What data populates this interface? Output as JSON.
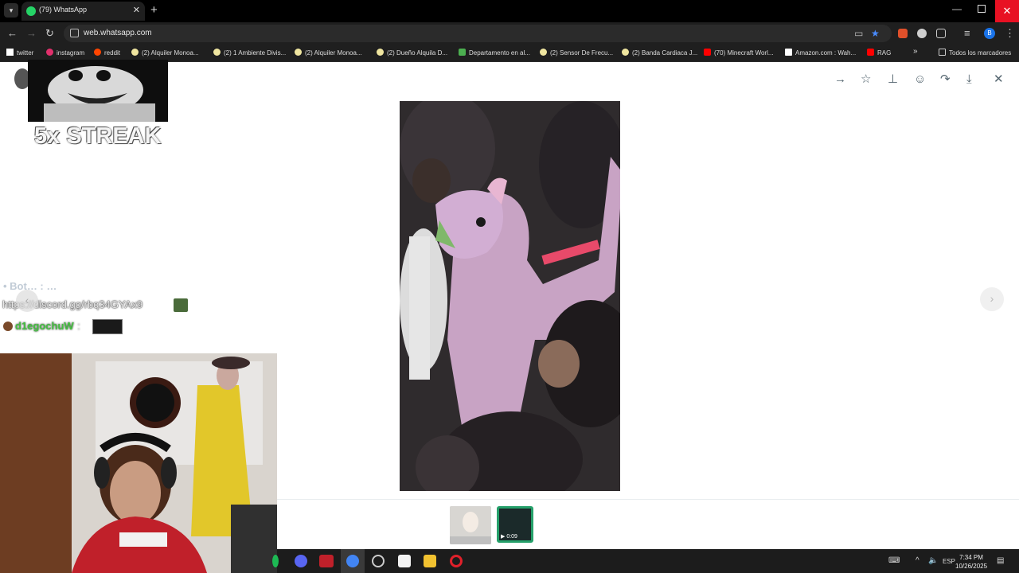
{
  "browser": {
    "tab_title": "(79) WhatsApp",
    "url": "web.whatsapp.com",
    "profile_initial": "B"
  },
  "bookmarks": [
    {
      "label": "twitter",
      "color": "#ffffff"
    },
    {
      "label": "instagram",
      "color": "#e1306c"
    },
    {
      "label": "reddit",
      "color": "#ff4500"
    },
    {
      "label": "(2) Alquiler Monoa...",
      "color": "#f0e6a0"
    },
    {
      "label": "(2) 1 Ambiente Divis...",
      "color": "#f0e6a0"
    },
    {
      "label": "(2) Alquiler Monoa...",
      "color": "#f0e6a0"
    },
    {
      "label": "(2) Dueño Alquila D...",
      "color": "#f0e6a0"
    },
    {
      "label": "Departamento en al...",
      "color": "#4caf50"
    },
    {
      "label": "(2) Sensor De Frecu...",
      "color": "#f0e6a0"
    },
    {
      "label": "(2) Banda Cardiaca J...",
      "color": "#f0e6a0"
    },
    {
      "label": "(70) Minecraft Worl...",
      "color": "#ff0000"
    },
    {
      "label": "Amazon.com : Wah...",
      "color": "#ffffff"
    },
    {
      "label": "RAG",
      "color": "#ff0000"
    }
  ],
  "bookmarks_more": "»",
  "all_bookmarks": "Todos los marcadores",
  "viewer": {
    "video_duration": "0:09"
  },
  "overlay": {
    "streak_text": "5x STREAK",
    "chat_faded": "• Bot… : …",
    "chat_link": "https://discord.gg/rbq34GYAx9",
    "chat_user": "d1egochuW",
    "chat_colon": ":"
  },
  "taskbar": {
    "language": "ESP",
    "time": "7:34 PM",
    "date": "10/26/2025"
  },
  "colors": {
    "whatsapp_green": "#25d366",
    "close_red": "#e81123",
    "icon_gray": "#54656f"
  }
}
